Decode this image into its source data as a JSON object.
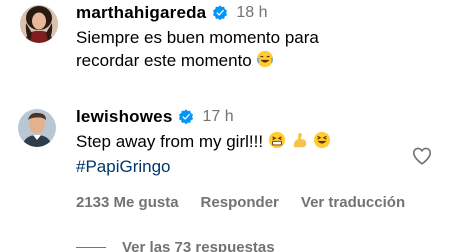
{
  "comments": [
    {
      "username": "marthahigareda",
      "time": "18 h",
      "text_lines": [
        "Siempre es buen momento para",
        "recordar este momento"
      ],
      "avatar_icon": "avatar-woman-icon",
      "verified_icon": "verified-badge-icon"
    },
    {
      "username": "lewishowes",
      "time": "17 h",
      "text": "Step away from my girl!!!",
      "hashtag": "#PapiGringo",
      "avatar_icon": "avatar-man-icon",
      "verified_icon": "verified-badge-icon",
      "actions": {
        "likes": "2133 Me gusta",
        "reply": "Responder",
        "translate": "Ver traducción"
      },
      "like_icon": "heart-outline-icon",
      "replies_label": "Ver las 73 respuestas"
    }
  ],
  "colors": {
    "verified": "#0095f6",
    "secondary_text": "#737373",
    "hashtag": "#00376b"
  }
}
